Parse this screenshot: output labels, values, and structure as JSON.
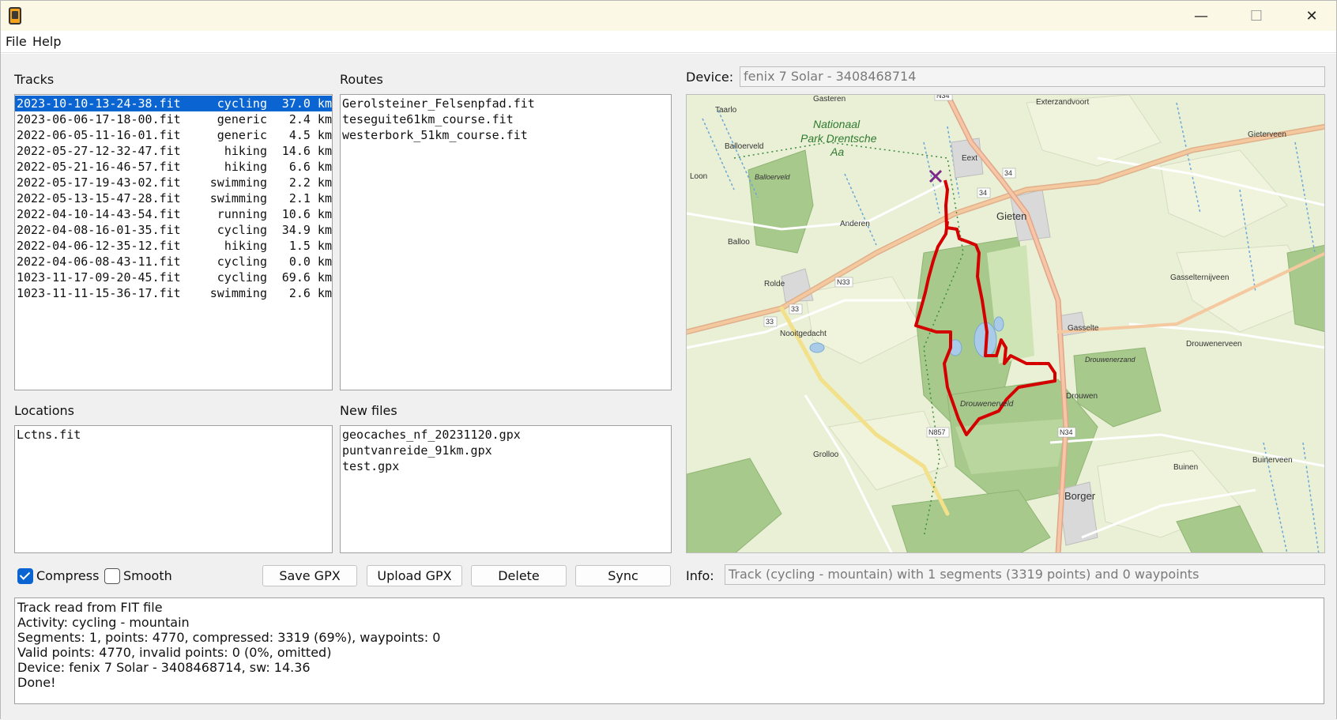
{
  "window": {
    "minimize_glyph": "—",
    "maximize_glyph": "☐",
    "close_glyph": "✕"
  },
  "menu": [
    "File",
    "Help"
  ],
  "tracks": {
    "label": "Tracks",
    "items": [
      {
        "name": "2023-10-10-13-24-38.fit",
        "type": "cycling",
        "dist": "37.0 km"
      },
      {
        "name": "2023-06-06-17-18-00.fit",
        "type": "generic",
        "dist": "2.4 km"
      },
      {
        "name": "2022-06-05-11-16-01.fit",
        "type": "generic",
        "dist": "4.5 km"
      },
      {
        "name": "2022-05-27-12-32-47.fit",
        "type": "hiking",
        "dist": "14.6 km"
      },
      {
        "name": "2022-05-21-16-46-57.fit",
        "type": "hiking",
        "dist": "6.6 km"
      },
      {
        "name": "2022-05-17-19-43-02.fit",
        "type": "swimming",
        "dist": "2.2 km"
      },
      {
        "name": "2022-05-13-15-47-28.fit",
        "type": "swimming",
        "dist": "2.1 km"
      },
      {
        "name": "2022-04-10-14-43-54.fit",
        "type": "running",
        "dist": "10.6 km"
      },
      {
        "name": "2022-04-08-16-01-35.fit",
        "type": "cycling",
        "dist": "34.9 km"
      },
      {
        "name": "2022-04-06-12-35-12.fit",
        "type": "hiking",
        "dist": "1.5 km"
      },
      {
        "name": "2022-04-06-08-43-11.fit",
        "type": "cycling",
        "dist": "0.0 km"
      },
      {
        "name": "1023-11-17-09-20-45.fit",
        "type": "cycling",
        "dist": "69.6 km"
      },
      {
        "name": "1023-11-11-15-36-17.fit",
        "type": "swimming",
        "dist": "2.6 km"
      }
    ]
  },
  "routes": {
    "label": "Routes",
    "items": [
      "Gerolsteiner_Felsenpfad.fit",
      "teseguite61km_course.fit",
      "westerbork_51km_course.fit"
    ]
  },
  "locations": {
    "label": "Locations",
    "items": [
      "Lctns.fit"
    ]
  },
  "new_files": {
    "label": "New files",
    "items": [
      "geocaches_nf_20231120.gpx",
      "puntvanreide_91km.gpx",
      "test.gpx"
    ]
  },
  "device": {
    "label": "Device:",
    "value": "fenix 7 Solar - 3408468714"
  },
  "options": {
    "compress_label": "Compress",
    "compress_checked": true,
    "smooth_label": "Smooth",
    "smooth_checked": false
  },
  "buttons": {
    "save_gpx": "Save GPX",
    "upload_gpx": "Upload GPX",
    "delete": "Delete",
    "sync": "Sync"
  },
  "info": {
    "label": "Info:",
    "value": "Track (cycling - mountain) with 1 segments (3319 points) and 0 waypoints"
  },
  "log": [
    "Track read from FIT file",
    "Activity: cycling - mountain",
    "Segments: 1, points: 4770, compressed: 3319 (69%), waypoints: 0",
    "Valid points: 4770, invalid points: 0 (0%, omitted)",
    "Device: fenix 7 Solar - 3408468714, sw: 14.36",
    "Done!"
  ],
  "map": {
    "park_name": [
      "Nationaal",
      "Park Drentsche",
      "Aa"
    ],
    "places": [
      {
        "name": "Gasteren"
      },
      {
        "name": "Taarlo"
      },
      {
        "name": "Balloerveld"
      },
      {
        "name": "Eext"
      },
      {
        "name": "Exterzandvoort"
      },
      {
        "name": "Gieterveen"
      },
      {
        "name": "Loon"
      },
      {
        "name": "Balloerveld"
      },
      {
        "name": "Anderen"
      },
      {
        "name": "Gieten"
      },
      {
        "name": "Balloo"
      },
      {
        "name": "Rolde"
      },
      {
        "name": "Gasselternijveen"
      },
      {
        "name": "Nooitgedacht"
      },
      {
        "name": "Gasselte"
      },
      {
        "name": "Drouwenerzand"
      },
      {
        "name": "Drouwenerveen"
      },
      {
        "name": "Drouwen"
      },
      {
        "name": "Drouwenerveld"
      },
      {
        "name": "Grolloo"
      },
      {
        "name": "Buinen"
      },
      {
        "name": "Buinerveen"
      },
      {
        "name": "Borger"
      }
    ],
    "roads": [
      "N34",
      "34",
      "34",
      "N33",
      "33",
      "33",
      "N857",
      "N34"
    ],
    "track_color": "#d40000",
    "start_marker_color": "#7b2a8a"
  }
}
